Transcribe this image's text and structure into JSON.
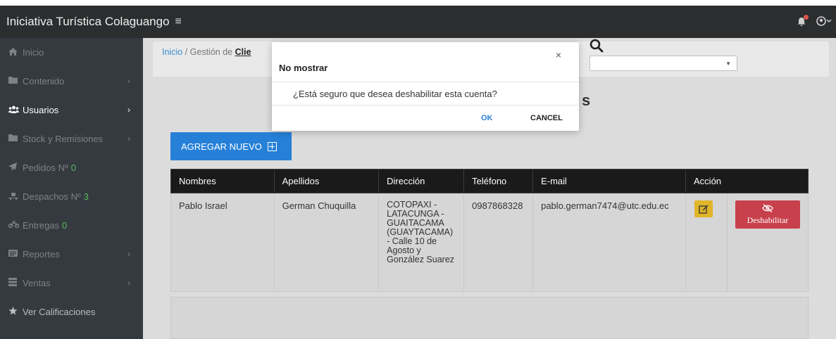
{
  "app": {
    "title": "Iniciativa Turística Colaguango",
    "menu_icon": "≡"
  },
  "topbar": {
    "notification_icon": "bell-icon",
    "user_icon": "user-circle-icon"
  },
  "sidebar": {
    "items": [
      {
        "label": "Inicio",
        "icon": "home-icon",
        "chevron": "",
        "count": ""
      },
      {
        "label": "Contenido",
        "icon": "folder-icon",
        "chevron": "›",
        "count": ""
      },
      {
        "label": "Usuarios",
        "icon": "users-icon",
        "chevron": "›",
        "count": ""
      },
      {
        "label": "Stock y Remisiones",
        "icon": "folder-icon",
        "chevron": "›",
        "count": ""
      },
      {
        "label": "Pedidos Nº",
        "icon": "send-icon",
        "chevron": "",
        "count": "0"
      },
      {
        "label": "Despachos Nº",
        "icon": "dolly-icon",
        "chevron": "",
        "count": "3"
      },
      {
        "label": "Entregas",
        "icon": "motorcycle-icon",
        "chevron": "",
        "count": "0"
      },
      {
        "label": "Reportes",
        "icon": "report-icon",
        "chevron": "›",
        "count": ""
      },
      {
        "label": "Ventas",
        "icon": "receipt-icon",
        "chevron": "›",
        "count": ""
      },
      {
        "label": "Ver Calificaciones",
        "icon": "star-icon",
        "chevron": "",
        "count": ""
      }
    ]
  },
  "breadcrumb": {
    "home": "Inicio",
    "separator": "/",
    "section": "Gestión de",
    "current": "Clie"
  },
  "page": {
    "title_fragment": "s"
  },
  "add_button": {
    "label": "AGREGAR NUEVO"
  },
  "table": {
    "headers": [
      "Nombres",
      "Apellidos",
      "Dirección",
      "Teléfono",
      "E-mail",
      "Acción"
    ],
    "rows": [
      {
        "nombres": "Pablo Israel",
        "apellidos": "German Chuquilla",
        "direccion": "COTOPAXI - LATACUNGA - GUAITACAMA (GUAYTACAMA) - Calle 10 de Agosto y González Suarez",
        "telefono": "0987868328",
        "email": "pablo.german7474@utc.edu.ec",
        "disable_label": "Deshabilitar"
      }
    ]
  },
  "modal": {
    "title": "No mostrar",
    "close": "×",
    "message": "¿Está seguro que desea deshabilitar esta cuenta?",
    "ok": "OK",
    "cancel": "CANCEL"
  },
  "colors": {
    "accent": "#2680d8",
    "danger": "#c8404b",
    "warning": "#e0b52a",
    "sidebar": "#343a40",
    "topbar": "#2b2d2f"
  }
}
